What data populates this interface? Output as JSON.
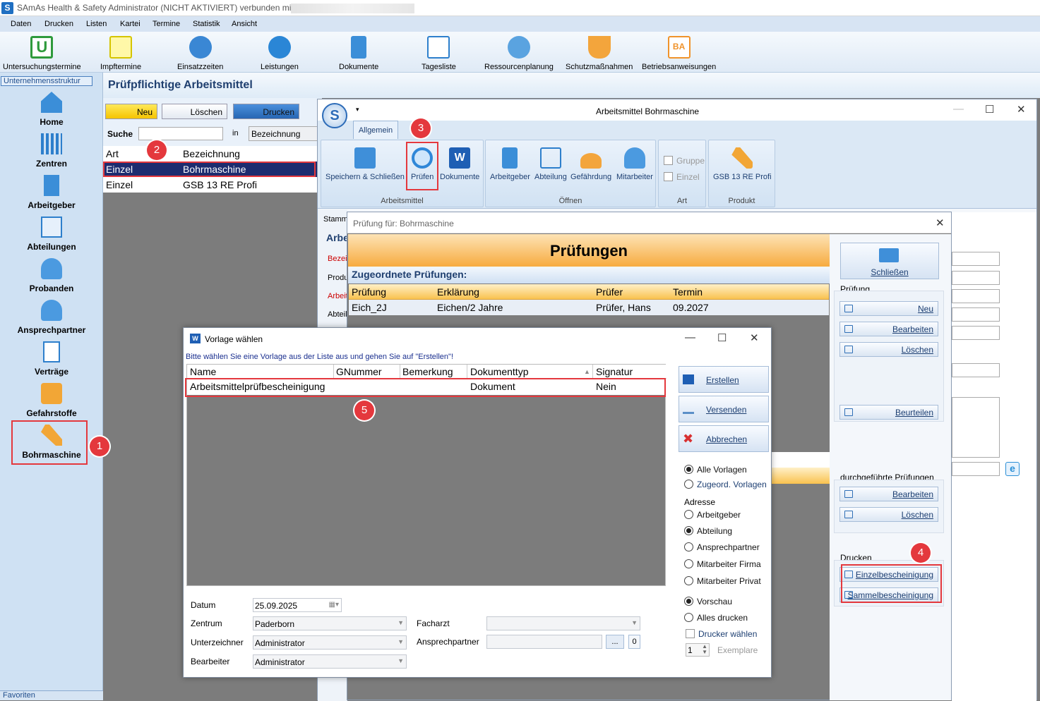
{
  "app": {
    "icon": "S",
    "title": "SAmAs Health & Safety  Administrator (NICHT AKTIVIERT)  verbunden mit"
  },
  "menu": [
    "Daten",
    "Drucken",
    "Listen",
    "Kartei",
    "Termine",
    "Statistik",
    "Ansicht"
  ],
  "ribbon": [
    "Untersuchungstermine",
    "Impftermine",
    "Einsatzzeiten",
    "Leistungen",
    "Dokumente",
    "Tagesliste",
    "Ressourcenplanung",
    "Schutzmaßnahmen",
    "Betriebsanweisungen"
  ],
  "left": {
    "header": "Unternehmensstruktur",
    "items": [
      "Home",
      "Zentren",
      "Arbeitgeber",
      "Abteilungen",
      "Probanden",
      "Ansprechpartner",
      "Verträge",
      "Gefahrstoffe",
      "Bohrmaschine"
    ],
    "favorites": "Favoriten"
  },
  "main": {
    "title": "Prüfpflichtige Arbeitsmittel",
    "new": "Neu",
    "delete": "Löschen",
    "print": "Drucken",
    "search_label": "Suche",
    "in_label": "in",
    "search_field": "Bezeichnung",
    "columns": [
      "Art",
      "Bezeichnung"
    ],
    "rows": [
      [
        "Einzel",
        "Bohrmaschine"
      ],
      [
        "Einzel",
        "GSB 13 RE Profi"
      ]
    ]
  },
  "winB": {
    "title": "Arbeitsmittel Bohrmaschine",
    "logo": "S",
    "tab": "Allgemein",
    "buttons": [
      "Speichern & Schließen",
      "Prüfen",
      "Dokumente",
      "Arbeitgeber",
      "Abteilung",
      "Gefährdung",
      "Mitarbeiter",
      "Gruppe",
      "Einzel",
      "GSB 13 RE Profi"
    ],
    "groups": [
      "Arbeitsmittel",
      "Öffnen",
      "Art",
      "Produkt"
    ],
    "side": [
      "Stammd",
      "Arbe",
      "Bezei",
      "Produ",
      "Arbeit",
      "Abteil"
    ]
  },
  "winC": {
    "title": "Prüfung für: Bohrmaschine",
    "banner": "Prüfungen",
    "sub": "Zugeordnete Prüfungen:",
    "columns": [
      "Prüfung",
      "Erklärung",
      "Prüfer",
      "Termin"
    ],
    "row": [
      "Eich_2J",
      "Eichen/2 Jahre",
      "Prüfer, Hans",
      "09.2027"
    ],
    "close": "Schließen",
    "sec_pruefung": "Prüfung",
    "new": "Neu",
    "edit": "Bearbeiten",
    "delete": "Löschen",
    "rate": "Beurteilen",
    "sec_done": "durchgeführte Prüfungen",
    "edit2": "Bearbeiten",
    "delete2": "Löschen",
    "sec_print": "Drucken",
    "single": "Einzelbescheinigung",
    "collective": "Sammelbescheinigung"
  },
  "winA": {
    "title": "Vorlage wählen",
    "hint": "Bitte wählen Sie eine Vorlage aus der Liste aus und gehen Sie auf \"Erstellen\"!",
    "columns": [
      "Name",
      "GNummer",
      "Bemerkung",
      "Dokumenttyp",
      "Signatur"
    ],
    "row": [
      "Arbeitsmittelprüfbescheinigung",
      "",
      "",
      "Dokument",
      "Nein"
    ],
    "create": "Erstellen",
    "send": "Versenden",
    "cancel": "Abbrechen",
    "all": "Alle Vorlagen",
    "assigned": "Zugeord. Vorlagen",
    "address": "Adresse",
    "addr": [
      "Arbeitgeber",
      "Abteilung",
      "Ansprechpartner",
      "Mitarbeiter Firma",
      "Mitarbeiter Privat"
    ],
    "preview": "Vorschau",
    "printall": "Alles drucken",
    "choose_printer": "Drucker wählen",
    "copies": "1",
    "copies_label": "Exemplare",
    "date_label": "Datum",
    "date": "25.09.2025",
    "center_label": "Zentrum",
    "center": "Paderborn",
    "signer_label": "Unterzeichner",
    "signer": "Administrator",
    "editor_label": "Bearbeiter",
    "editor": "Administrator",
    "doctor_label": "Facharzt",
    "contact_label": "Ansprechpartner",
    "contact_btn": "...",
    "contact_count": "0"
  },
  "badges": [
    "1",
    "2",
    "3",
    "4",
    "5"
  ]
}
